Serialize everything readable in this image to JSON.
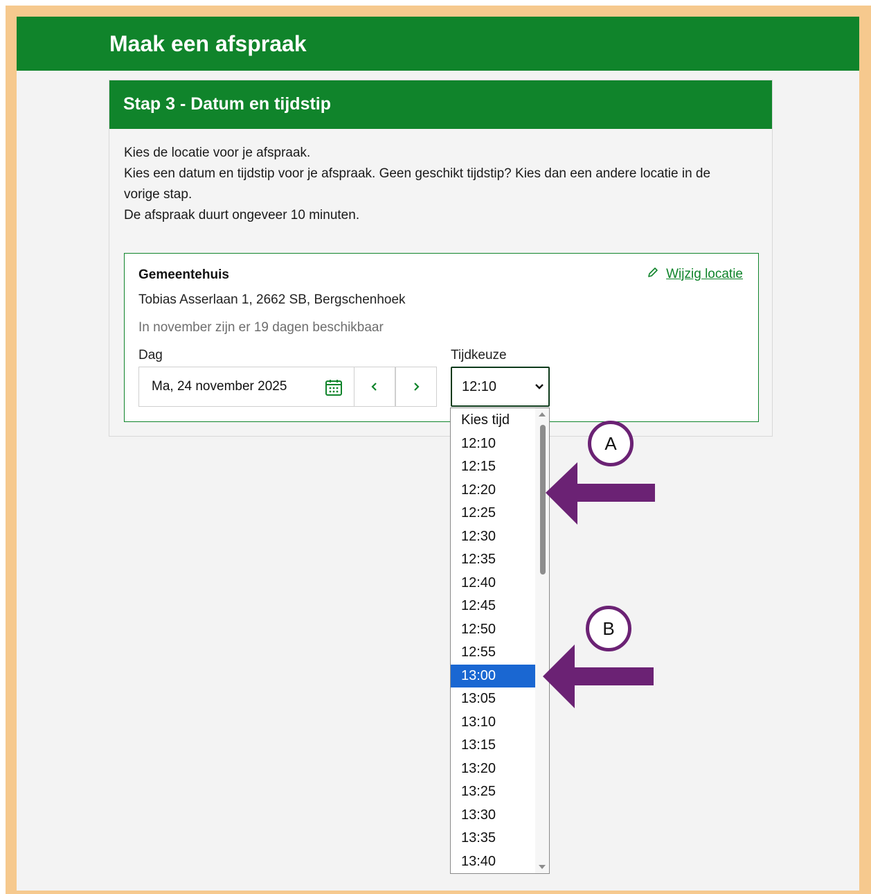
{
  "header": {
    "title": "Maak een afspraak"
  },
  "step": {
    "title": "Stap 3 - Datum en tijdstip",
    "intro_line1": "Kies de locatie voor je afspraak.",
    "intro_line2": "Kies een datum en tijdstip voor je afspraak. Geen geschikt tijdstip? Kies dan een andere locatie in de",
    "intro_line3": "vorige stap.",
    "intro_line4": "De afspraak duurt ongeveer 10 minuten."
  },
  "location": {
    "name": "Gemeentehuis",
    "address": "Tobias Asserlaan 1, 2662 SB, Bergschenhoek",
    "availability": "In november zijn er 19 dagen beschikbaar",
    "change_label": "Wijzig locatie"
  },
  "day_field": {
    "label": "Dag",
    "value": "Ma, 24 november 2025"
  },
  "time_field": {
    "label": "Tijdkeuze",
    "value": "12:10",
    "options": [
      "Kies tijd",
      "12:10",
      "12:15",
      "12:20",
      "12:25",
      "12:30",
      "12:35",
      "12:40",
      "12:45",
      "12:50",
      "12:55",
      "13:00",
      "13:05",
      "13:10",
      "13:15",
      "13:20",
      "13:25",
      "13:30",
      "13:35",
      "13:40"
    ],
    "highlighted": "13:00"
  },
  "annotations": {
    "a": "A",
    "b": "B"
  },
  "colors": {
    "brand_green": "#10842b",
    "highlight_blue": "#1a67d2",
    "callout_purple": "#6b2274",
    "frame_orange": "#f6c98e"
  }
}
